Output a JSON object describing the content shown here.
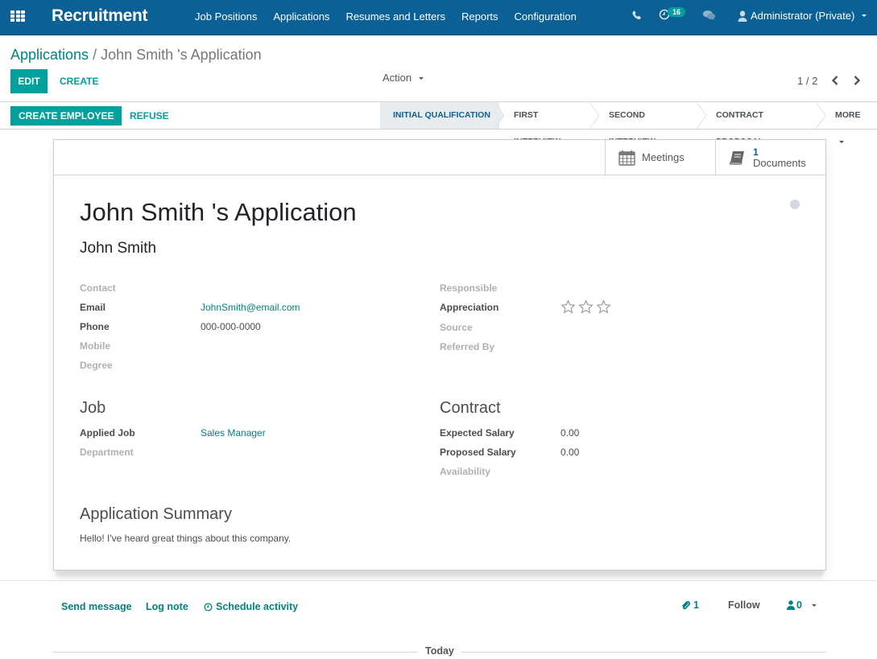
{
  "navbar": {
    "app_name": "Recruitment",
    "menu": [
      "Job Positions",
      "Applications",
      "Resumes and Letters",
      "Reports",
      "Configuration"
    ],
    "activity_count": "16",
    "user": "Administrator (Private)",
    "icons": [
      "apps-grid-icon",
      "phone-icon",
      "clock-icon",
      "chat-bubbles-icon",
      "user-icon"
    ]
  },
  "control_panel": {
    "breadcrumb": {
      "parent": "Applications",
      "separator": "/",
      "current": "John Smith 's Application"
    },
    "edit_label": "Edit",
    "create_label": "Create",
    "action_label": "Action",
    "pager": "1 / 2"
  },
  "statusbar": {
    "create_employee_label": "Create Employee",
    "refuse_label": "Refuse",
    "stages": [
      {
        "label": "Initial Qualification",
        "active": true
      },
      {
        "label": "First Interview",
        "active": false
      },
      {
        "label": "Second Interview",
        "active": false
      },
      {
        "label": "Contract Proposal",
        "active": false
      },
      {
        "label": "More",
        "active": false
      }
    ]
  },
  "button_box": {
    "meetings_label": "Meetings",
    "documents_count": "1",
    "documents_label": "Documents"
  },
  "form": {
    "title": "John Smith 's Application",
    "partner_name": "John Smith",
    "left_fields": [
      {
        "label": "Contact",
        "value": ""
      },
      {
        "label": "Email",
        "value": "JohnSmith@email.com"
      },
      {
        "label": "Phone",
        "value": "000-000-0000"
      },
      {
        "label": "Mobile",
        "value": ""
      },
      {
        "label": "Degree",
        "value": ""
      }
    ],
    "right_fields": [
      {
        "label": "Responsible",
        "value": ""
      },
      {
        "label": "Appreciation",
        "stars_filled": 0,
        "stars_total": 3
      },
      {
        "label": "Source",
        "value": ""
      },
      {
        "label": "Referred By",
        "value": ""
      }
    ],
    "job_section": {
      "title": "Job",
      "fields": [
        {
          "label": "Applied Job",
          "value": "Sales Manager"
        },
        {
          "label": "Department",
          "value": ""
        }
      ]
    },
    "contract_section": {
      "title": "Contract",
      "fields": [
        {
          "label": "Expected Salary",
          "value": "0.00"
        },
        {
          "label": "Proposed Salary",
          "value": "0.00"
        },
        {
          "label": "Availability",
          "value": ""
        }
      ]
    },
    "summary": {
      "title": "Application Summary",
      "text": "Hello! I've heard great things about this company."
    }
  },
  "chatter": {
    "send_message": "Send message",
    "log_note": "Log note",
    "schedule_activity": "Schedule activity",
    "attachments_count": "1",
    "follow": "Follow",
    "followers_count": "0",
    "date_separator": "Today"
  }
}
